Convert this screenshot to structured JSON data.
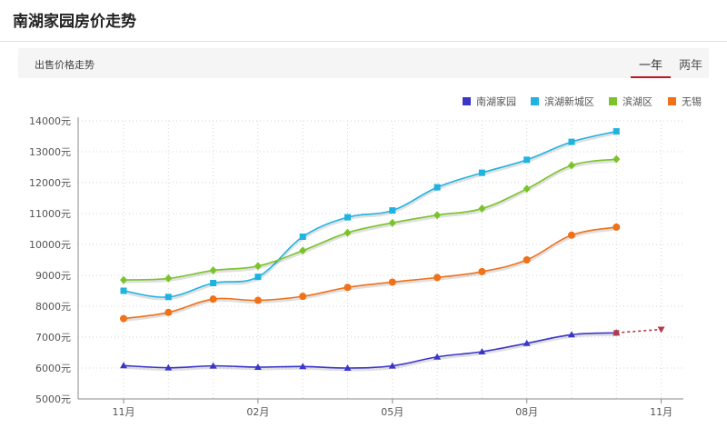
{
  "page": {
    "title": "南湖家园房价走势"
  },
  "subbar": {
    "label": "出售价格走势",
    "tabs": [
      {
        "label": "一年",
        "active": true
      },
      {
        "label": "两年",
        "active": false
      }
    ]
  },
  "chart_data": {
    "type": "line",
    "x": [
      "2018-11",
      "2018-12",
      "2019-01",
      "2019-02",
      "2019-03",
      "2019-04",
      "2019-05",
      "2019-06",
      "2019-07",
      "2019-08",
      "2019-09",
      "2019-10",
      "2019-11"
    ],
    "x_tick_labels": [
      {
        "x": "2018-11",
        "label": "11月"
      },
      {
        "x": "2019-02",
        "label": "02月"
      },
      {
        "x": "2019-05",
        "label": "05月"
      },
      {
        "x": "2019-08",
        "label": "08月"
      },
      {
        "x": "2019-11",
        "label": "11月"
      }
    ],
    "ylim": [
      5000,
      14000
    ],
    "y_ticks": [
      5000,
      6000,
      7000,
      8000,
      9000,
      10000,
      11000,
      12000,
      13000,
      14000
    ],
    "y_unit": "元",
    "grid": true,
    "legend_position": "top-right",
    "series": [
      {
        "name": "南湖家园",
        "color": "#3a36c8",
        "marker": "triangle",
        "values": [
          6080,
          6010,
          6070,
          6030,
          6050,
          6000,
          6070,
          6360,
          6530,
          6800,
          7080,
          7140,
          null
        ],
        "forecast": [
          7140,
          7250
        ]
      },
      {
        "name": "滨湖新城区",
        "color": "#1fb3e0",
        "marker": "square",
        "values": [
          8500,
          8300,
          8750,
          8950,
          10250,
          10880,
          11100,
          11850,
          12320,
          12740,
          13320,
          13660,
          null
        ]
      },
      {
        "name": "滨湖区",
        "color": "#7ac42a",
        "marker": "diamond",
        "values": [
          8850,
          8900,
          9160,
          9300,
          9800,
          10380,
          10700,
          10950,
          11160,
          11800,
          12560,
          12760,
          null
        ]
      },
      {
        "name": "无锡",
        "color": "#f07118",
        "marker": "circle",
        "values": [
          7600,
          7800,
          8230,
          8190,
          8320,
          8610,
          8780,
          8930,
          9120,
          9500,
          10300,
          10560,
          null
        ]
      }
    ]
  }
}
